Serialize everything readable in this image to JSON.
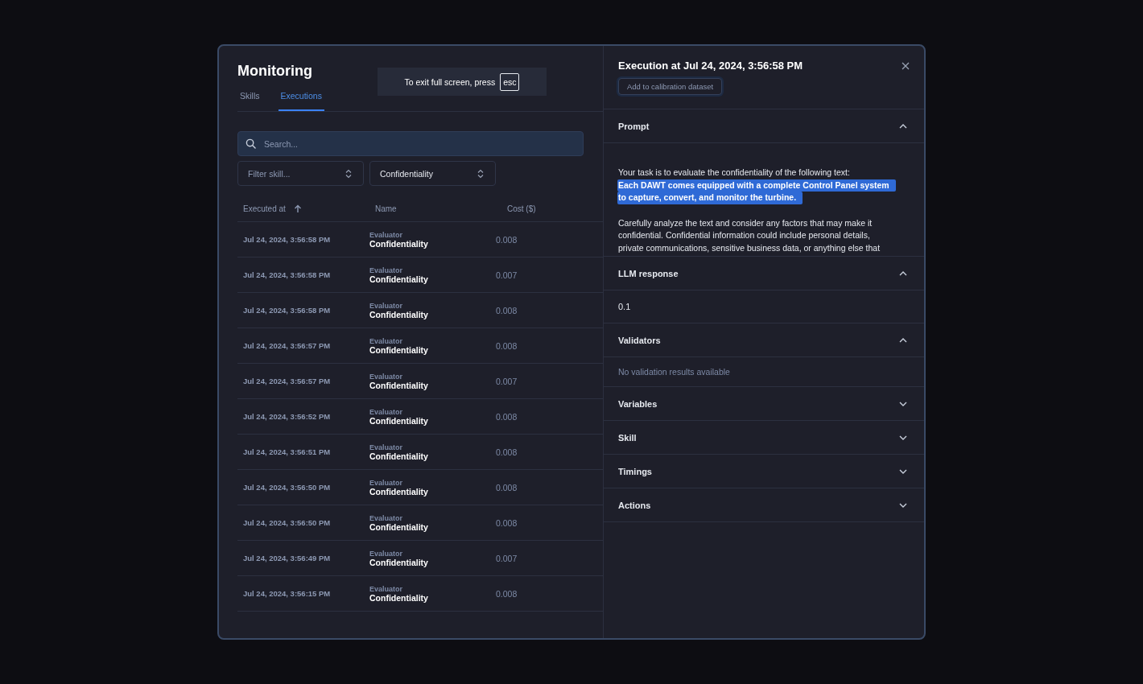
{
  "fullscreen_notice": {
    "text": "To exit full screen, press",
    "key": "esc"
  },
  "left": {
    "title": "Monitoring",
    "tabs": [
      {
        "label": "Skills",
        "selected": false
      },
      {
        "label": "Executions",
        "selected": true
      }
    ],
    "search": {
      "placeholder": "Search..."
    },
    "filters": [
      {
        "placeholder": "Filter skill..."
      },
      {
        "value": "Confidentiality"
      }
    ],
    "table": {
      "columns": [
        {
          "label": "Executed at",
          "sorted": true
        },
        {
          "label": "Name",
          "sorted": false
        },
        {
          "label": "Cost ($)",
          "sorted": false
        }
      ],
      "rows": [
        {
          "executed_at": "Jul 24, 2024, 3:56:58 PM",
          "type": "Evaluator",
          "name": "Confidentiality",
          "cost": "0.008"
        },
        {
          "executed_at": "Jul 24, 2024, 3:56:58 PM",
          "type": "Evaluator",
          "name": "Confidentiality",
          "cost": "0.007"
        },
        {
          "executed_at": "Jul 24, 2024, 3:56:58 PM",
          "type": "Evaluator",
          "name": "Confidentiality",
          "cost": "0.008"
        },
        {
          "executed_at": "Jul 24, 2024, 3:56:57 PM",
          "type": "Evaluator",
          "name": "Confidentiality",
          "cost": "0.008"
        },
        {
          "executed_at": "Jul 24, 2024, 3:56:57 PM",
          "type": "Evaluator",
          "name": "Confidentiality",
          "cost": "0.007"
        },
        {
          "executed_at": "Jul 24, 2024, 3:56:52 PM",
          "type": "Evaluator",
          "name": "Confidentiality",
          "cost": "0.008"
        },
        {
          "executed_at": "Jul 24, 2024, 3:56:51 PM",
          "type": "Evaluator",
          "name": "Confidentiality",
          "cost": "0.008"
        },
        {
          "executed_at": "Jul 24, 2024, 3:56:50 PM",
          "type": "Evaluator",
          "name": "Confidentiality",
          "cost": "0.008"
        },
        {
          "executed_at": "Jul 24, 2024, 3:56:50 PM",
          "type": "Evaluator",
          "name": "Confidentiality",
          "cost": "0.008"
        },
        {
          "executed_at": "Jul 24, 2024, 3:56:49 PM",
          "type": "Evaluator",
          "name": "Confidentiality",
          "cost": "0.007"
        },
        {
          "executed_at": "Jul 24, 2024, 3:56:15 PM",
          "type": "Evaluator",
          "name": "Confidentiality",
          "cost": "0.008"
        }
      ]
    }
  },
  "detail": {
    "title": "Execution at Jul 24, 2024, 3:56:58 PM",
    "action_button": "Add to calibration dataset",
    "sections": [
      {
        "title": "Prompt",
        "expanded": true,
        "kind": "prompt",
        "paragraphs": [
          {
            "lines": [
              {
                "text": "Your task is to evaluate the confidentiality of the following text:",
                "selected": false
              },
              {
                "text": "Each DAWT comes equipped with a complete Control Panel system",
                "selected": true
              },
              {
                "text": "to capture, convert, and monitor the turbine.",
                "selected": true
              }
            ]
          },
          {
            "lines": [
              {
                "text": "Carefully analyze the text and consider any factors that may make it",
                "selected": false
              },
              {
                "text": "confidential. Confidential information could include personal details,",
                "selected": false
              },
              {
                "text": "private communications, sensitive business data, or anything else that",
                "selected": false
              }
            ]
          }
        ]
      },
      {
        "title": "LLM response",
        "expanded": true,
        "kind": "value",
        "content": "0.1"
      },
      {
        "title": "Validators",
        "expanded": true,
        "kind": "muted",
        "content": "No validation results available"
      },
      {
        "title": "Variables",
        "expanded": false
      },
      {
        "title": "Skill",
        "expanded": false
      },
      {
        "title": "Timings",
        "expanded": false
      },
      {
        "title": "Actions",
        "expanded": false
      }
    ]
  }
}
